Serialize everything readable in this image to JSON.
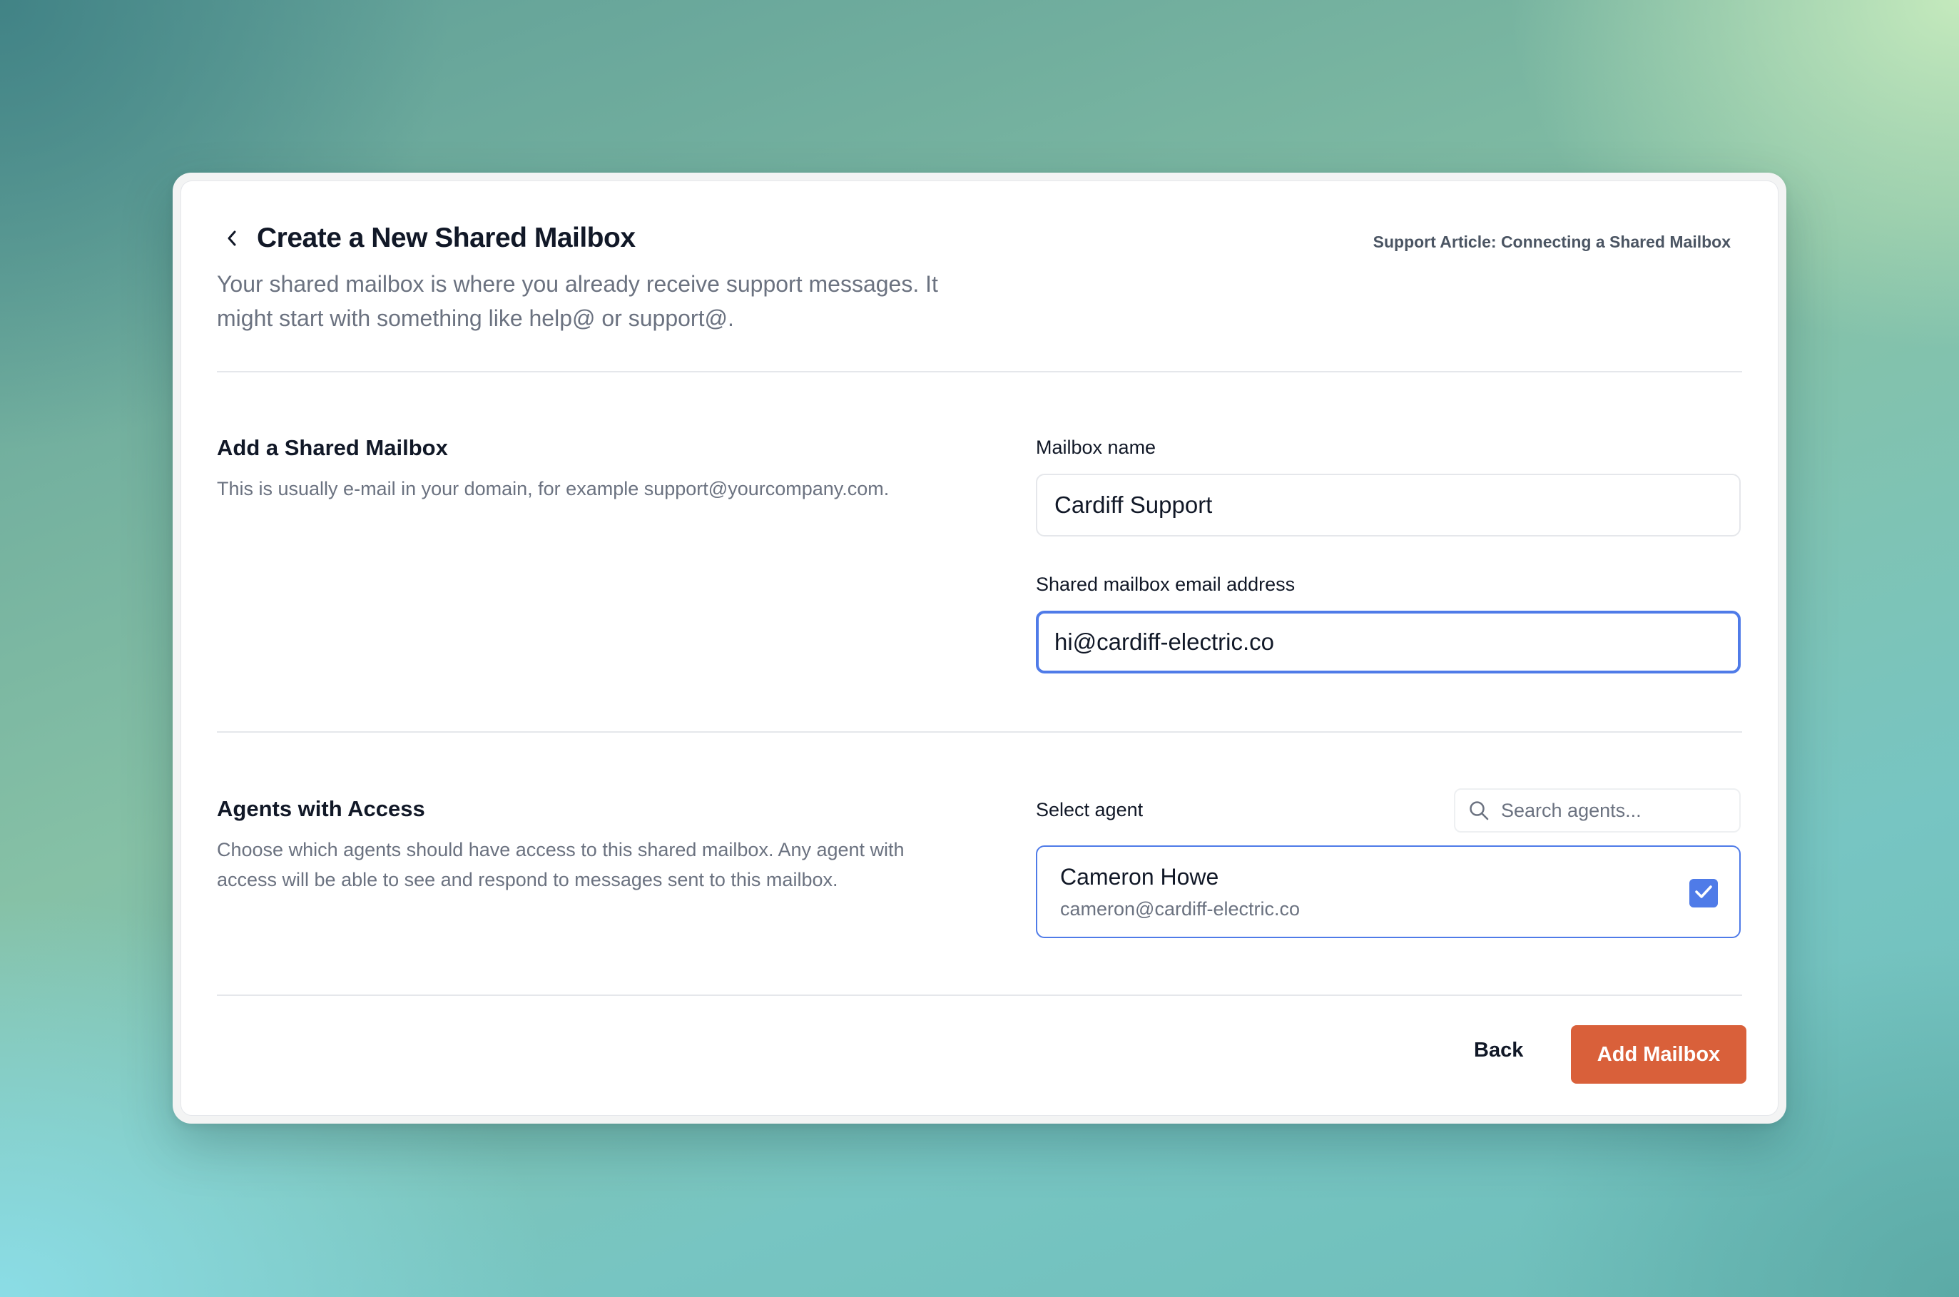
{
  "header": {
    "title": "Create a New Shared Mailbox",
    "subtitle": "Your shared mailbox is where you already receive support messages. It might start with something like help@ or support@.",
    "support_link": "Support Article: Connecting a Shared Mailbox",
    "back_icon": "chevron-left-icon"
  },
  "mailbox_section": {
    "title": "Add a Shared Mailbox",
    "description": "This is usually e-mail in your domain, for example support@yourcompany.com.",
    "name_label": "Mailbox name",
    "name_value": "Cardiff Support",
    "email_label": "Shared mailbox email address",
    "email_value": "hi@cardiff-electric.co"
  },
  "agents_section": {
    "title": "Agents with Access",
    "description": "Choose which agents should have access to this shared mailbox. Any agent with access will be able to see and respond to messages sent to this mailbox.",
    "select_label": "Select agent",
    "search_placeholder": "Search agents...",
    "search_icon": "search-icon",
    "agents": [
      {
        "name": "Cameron Howe",
        "email": "cameron@cardiff-electric.co",
        "checked": true
      }
    ]
  },
  "footer": {
    "back_label": "Back",
    "submit_label": "Add Mailbox"
  },
  "colors": {
    "accent": "#4f7be8",
    "primary_button": "#d9603a"
  }
}
